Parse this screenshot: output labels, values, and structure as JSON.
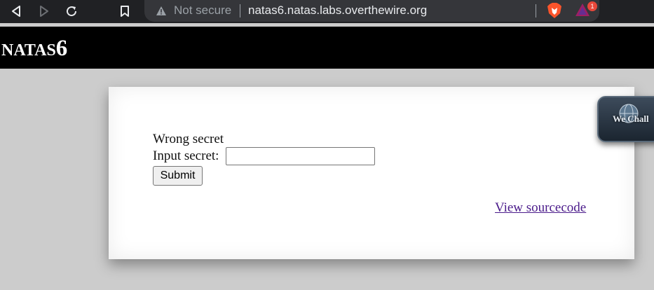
{
  "browser": {
    "security_label": "Not secure",
    "url": "natas6.natas.labs.overthewire.org",
    "rewards_badge": "1",
    "icons": [
      "back-icon",
      "forward-icon",
      "reload-icon",
      "bookmark-icon",
      "warning-icon",
      "brave-shields-icon",
      "brave-rewards-icon"
    ]
  },
  "header": {
    "title_small": "NATAS",
    "title_big": "6"
  },
  "form": {
    "message": "Wrong secret",
    "input_label": "Input secret:",
    "input_value": "",
    "submit_label": "Submit"
  },
  "links": {
    "view_source": "View sourcecode"
  },
  "widget": {
    "label": "We Chall"
  },
  "colors": {
    "chrome_bg": "#202124",
    "omnibox_bg": "#35363a",
    "header_bg": "#000000",
    "page_bg": "#cccccc",
    "content_bg": "#ffffff",
    "link_color": "#4a1a8a"
  }
}
